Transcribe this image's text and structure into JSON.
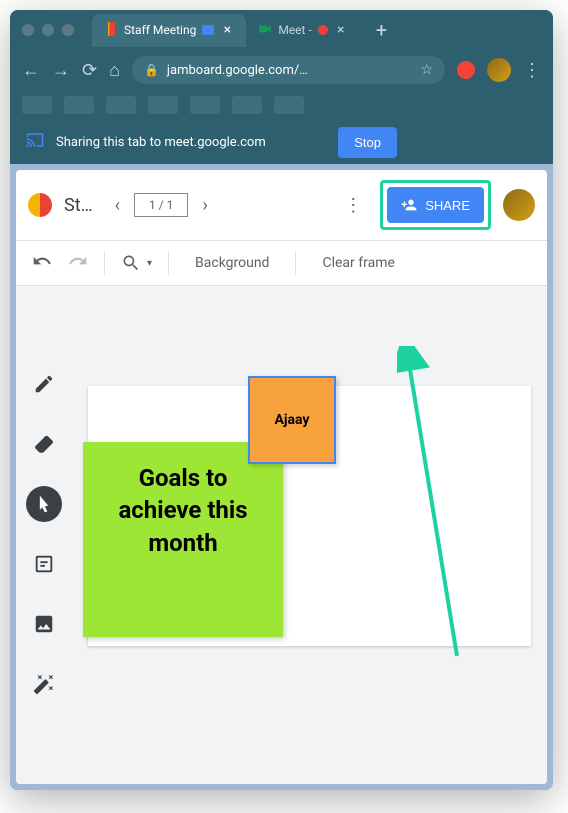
{
  "browser": {
    "tabs": [
      {
        "label": "Staff Meeting",
        "active": true
      },
      {
        "label": "Meet -",
        "active": false
      }
    ],
    "url": "jamboard.google.com/…",
    "sharing_message": "Sharing this tab to meet.google.com",
    "stop_label": "Stop"
  },
  "app": {
    "title": "St…",
    "frame_counter": "1 / 1",
    "share_label": "SHARE",
    "toolbar": {
      "background_label": "Background",
      "clear_label": "Clear frame"
    }
  },
  "stickies": {
    "green": "Goals to achieve this month",
    "orange": "Ajaay"
  },
  "colors": {
    "highlight": "#1dd1a1",
    "primary": "#4285f4"
  }
}
